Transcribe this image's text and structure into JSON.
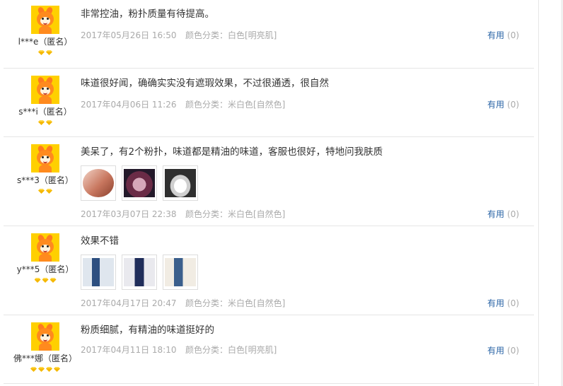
{
  "reviews": [
    {
      "user": "l***e（匿名）",
      "badge_count": 2,
      "text": "非常控油，粉扑质量有待提高。",
      "date": "2017年05月26日 16:50",
      "sku": "颜色分类：白色[明亮肌]",
      "useful_label": "有用",
      "useful_count": "(0)",
      "photos": []
    },
    {
      "user": "s***i（匿名）",
      "badge_count": 2,
      "text": "味道很好闻，确确实实没有遮瑕效果，不过很通透，很自然",
      "date": "2017年04月06日 11:26",
      "sku": "颜色分类：米白色[自然色]",
      "useful_label": "有用",
      "useful_count": "(0)",
      "photos": []
    },
    {
      "user": "s***3（匿名）",
      "badge_count": 2,
      "text": "美呆了，有2个粉扑，味道都是精油的味道，客服也很好，特地问我肤质",
      "date": "2017年03月07日 22:38",
      "sku": "颜色分类：米白色[自然色]",
      "useful_label": "有用",
      "useful_count": "(0)",
      "photos": [
        {
          "icon": "compact-photo",
          "color_a": "#e8b9a9",
          "color_b": "#b0604a"
        },
        {
          "icon": "compact-open-photo",
          "color_a": "#7a3b55",
          "color_b": "#cfa0b2"
        },
        {
          "icon": "powder-puff-photo",
          "color_a": "#3b3b3b",
          "color_b": "#eaeaea"
        }
      ]
    },
    {
      "user": "y***5（匿名）",
      "badge_count": 3,
      "text": "效果不错",
      "date": "2017年04月17日 20:47",
      "sku": "颜色分类：米白色[自然色]",
      "useful_label": "有用",
      "useful_count": "(0)",
      "photos": [
        {
          "icon": "person-photo",
          "color_a": "#dfe6ee",
          "color_b": "#2d4f80"
        },
        {
          "icon": "person-photo",
          "color_a": "#e9e9ee",
          "color_b": "#1f2d5a"
        },
        {
          "icon": "person-photo",
          "color_a": "#f1ece3",
          "color_b": "#3b5f8c"
        }
      ]
    },
    {
      "user": "佛***娜（匿名）",
      "badge_count": 4,
      "text": "粉质细腻，有精油的味道挺好的",
      "date": "2017年04月11日 18:10",
      "sku": "颜色分类：白色[明亮肌]",
      "useful_label": "有用",
      "useful_count": "(0)",
      "photos": []
    }
  ]
}
